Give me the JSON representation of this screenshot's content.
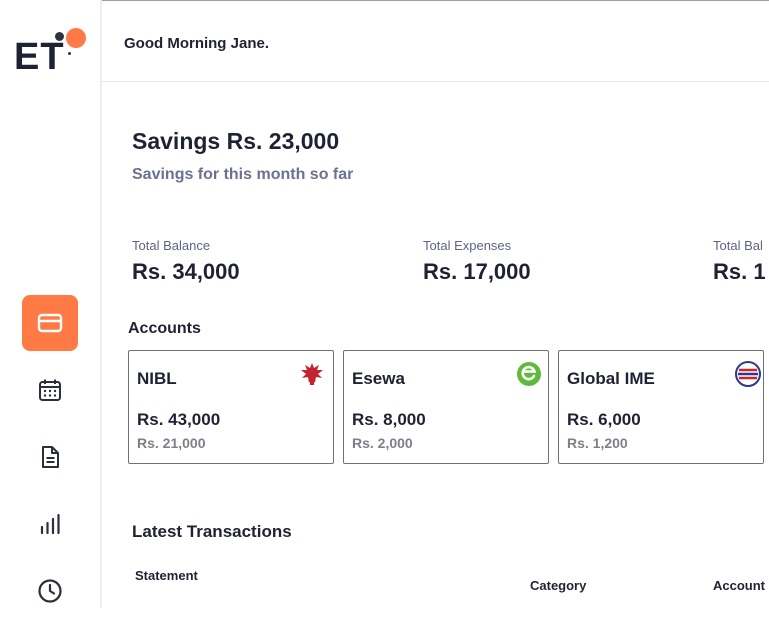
{
  "app": {
    "logo_text": "ET"
  },
  "header": {
    "greeting": "Good Morning Jane."
  },
  "savings": {
    "title": "Savings Rs. 23,000",
    "subtitle": "Savings for this month so far"
  },
  "stats": [
    {
      "label": "Total Balance",
      "value": "Rs. 34,000"
    },
    {
      "label": "Total Expenses",
      "value": "Rs. 17,000"
    },
    {
      "label": "Total Bal",
      "value": "Rs. 1"
    }
  ],
  "accounts": {
    "title": "Accounts",
    "items": [
      {
        "name": "NIBL",
        "balance": "Rs. 43,000",
        "secondary": "Rs. 21,000",
        "icon": "nibl-logo-icon",
        "color": "#c2252f"
      },
      {
        "name": "Esewa",
        "balance": "Rs. 8,000",
        "secondary": "Rs. 2,000",
        "icon": "esewa-logo-icon",
        "color": "#5fb93a"
      },
      {
        "name": "Global IME",
        "balance": "Rs. 6,000",
        "secondary": "Rs. 1,200",
        "icon": "global-ime-logo-icon",
        "color": "#2d3a8c"
      }
    ]
  },
  "transactions": {
    "title": "Latest Transactions",
    "columns": [
      "Statement",
      "Category",
      "Account"
    ]
  },
  "sidebar": {
    "items": [
      {
        "icon": "card-icon",
        "active": true
      },
      {
        "icon": "calendar-icon",
        "active": false
      },
      {
        "icon": "document-icon",
        "active": false
      },
      {
        "icon": "bar-chart-icon",
        "active": false
      },
      {
        "icon": "clock-icon",
        "active": false
      }
    ]
  },
  "colors": {
    "accent": "#ff7a45",
    "text": "#1f2233",
    "muted": "#6c7191"
  }
}
